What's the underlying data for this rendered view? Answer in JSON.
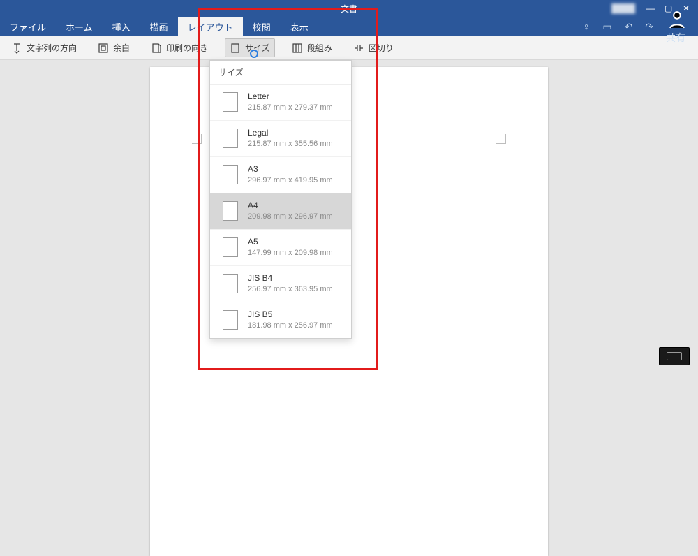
{
  "titlebar": {
    "doc_title": "文書",
    "user": "████",
    "win": {
      "min": "—",
      "max": "▢",
      "close": "✕"
    }
  },
  "menubar": {
    "tabs": [
      {
        "label": "ファイル"
      },
      {
        "label": "ホーム"
      },
      {
        "label": "挿入"
      },
      {
        "label": "描画"
      },
      {
        "label": "レイアウト",
        "active": true
      },
      {
        "label": "校閲"
      },
      {
        "label": "表示"
      }
    ],
    "right": {
      "lightbulb": "♡",
      "book": "▭",
      "undo": "↶",
      "redo": "↷",
      "share": "共有"
    }
  },
  "ribbon": {
    "items": [
      {
        "key": "text-direction",
        "label": "文字列の方向"
      },
      {
        "key": "margins",
        "label": "余白"
      },
      {
        "key": "orientation",
        "label": "印刷の向き"
      },
      {
        "key": "size",
        "label": "サイズ",
        "active": true
      },
      {
        "key": "columns",
        "label": "段組み"
      },
      {
        "key": "breaks",
        "label": "区切り"
      }
    ]
  },
  "size_dropdown": {
    "header": "サイズ",
    "options": [
      {
        "name": "Letter",
        "dims": "215.87 mm x 279.37 mm"
      },
      {
        "name": "Legal",
        "dims": "215.87 mm x 355.56 mm"
      },
      {
        "name": "A3",
        "dims": "296.97 mm x 419.95 mm"
      },
      {
        "name": "A4",
        "dims": "209.98 mm x 296.97 mm",
        "selected": true
      },
      {
        "name": "A5",
        "dims": "147.99 mm x 209.98 mm"
      },
      {
        "name": "JIS B4",
        "dims": "256.97 mm x 363.95 mm"
      },
      {
        "name": "JIS B5",
        "dims": "181.98 mm x 256.97 mm"
      }
    ]
  }
}
